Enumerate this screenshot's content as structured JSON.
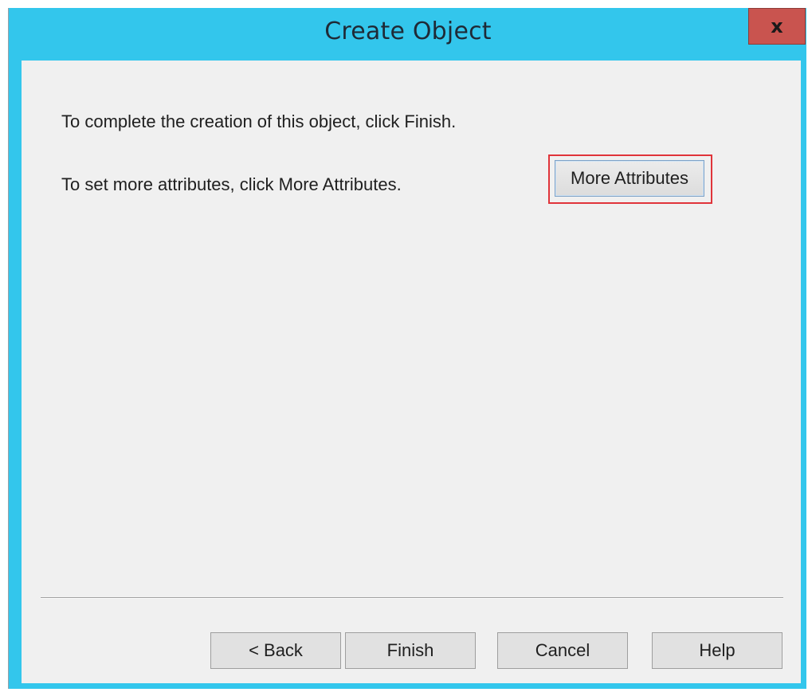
{
  "window": {
    "title": "Create Object",
    "close_glyph": "x",
    "close_icon": "close-icon",
    "title_bar_color": "#33c6ec",
    "close_button_color": "#c9544f"
  },
  "body": {
    "finish_instruction": "To complete the creation of this object, click Finish.",
    "attributes_instruction": "To set more attributes, click More Attributes.",
    "more_attributes_label": "More Attributes",
    "highlight_color": "#e0343a"
  },
  "footer": {
    "back_label": "< Back",
    "finish_label": "Finish",
    "cancel_label": "Cancel",
    "help_label": "Help"
  }
}
